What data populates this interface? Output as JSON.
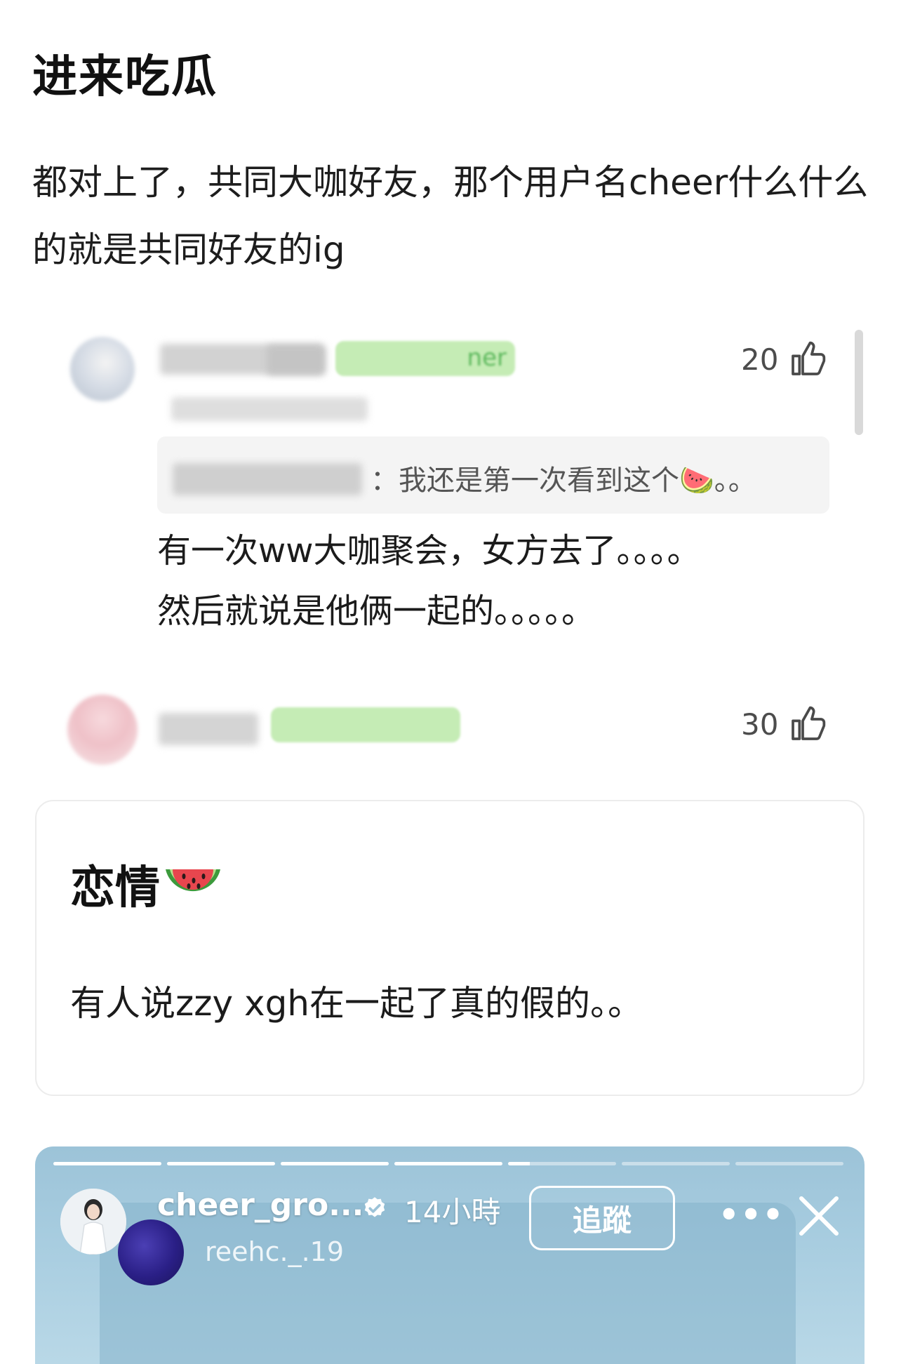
{
  "post": {
    "title": "进来吃瓜",
    "body": "都对上了，共同大咖好友，那个用户名cheer什么什么的就是共同好友的ig"
  },
  "comment_screenshot": {
    "comments": [
      {
        "tag_visible_fragment": "ner",
        "likes": "20",
        "quote_text": "：我还是第一次看到这个🍉。。",
        "reply_lines": [
          "有一次ww大咖聚会，女方去了。。。。",
          "然后就说是他俩一起的。。。。。"
        ]
      },
      {
        "likes": "30"
      }
    ]
  },
  "post_screenshot": {
    "title": "恋情",
    "title_emoji": "watermelon",
    "body": "有人说zzy xgh在一起了真的假的。。"
  },
  "story_screenshot": {
    "username": "cheer_gro...",
    "time": "14小時",
    "follow_label": "追蹤",
    "sub_username": "reehc._.19",
    "more_icon": "more-horizontal-icon",
    "close_icon": "close-icon",
    "progress_segments": 7,
    "active_segment": 5
  },
  "colors": {
    "tag_green": "#5cb85c",
    "story_bg": "#a8cde0",
    "sub_avatar": "#2a1f86"
  }
}
